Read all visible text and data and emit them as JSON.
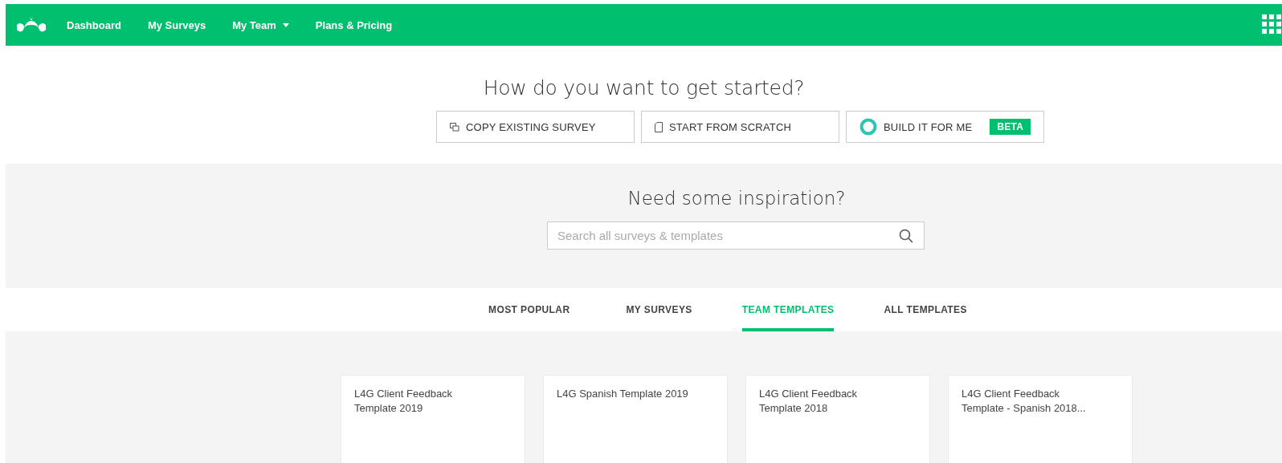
{
  "nav": {
    "items": [
      {
        "label": "Dashboard",
        "dropdown": false
      },
      {
        "label": "My Surveys",
        "dropdown": false
      },
      {
        "label": "My Team",
        "dropdown": true
      },
      {
        "label": "Plans & Pricing",
        "dropdown": false
      }
    ]
  },
  "start": {
    "title": "How do you want to get started?",
    "options": [
      {
        "kind": "copy",
        "label": "COPY EXISTING SURVEY"
      },
      {
        "kind": "scratch",
        "label": "START FROM SCRATCH"
      },
      {
        "kind": "build",
        "label": "BUILD IT FOR ME",
        "badge": "BETA"
      }
    ]
  },
  "inspiration": {
    "title": "Need some inspiration?",
    "search": {
      "placeholder": "Search all surveys & templates"
    }
  },
  "tabs": [
    {
      "label": "MOST POPULAR",
      "selected": false
    },
    {
      "label": "MY SURVEYS",
      "selected": false
    },
    {
      "label": "TEAM TEMPLATES",
      "selected": true
    },
    {
      "label": "ALL TEMPLATES",
      "selected": false
    }
  ],
  "templates": [
    {
      "title": "L4G Client Feedback Template 2019"
    },
    {
      "title": "L4G Spanish Template 2019"
    },
    {
      "title": "L4G Client Feedback Template 2018"
    },
    {
      "title": "L4G Client Feedback Template - Spanish 2018..."
    }
  ]
}
